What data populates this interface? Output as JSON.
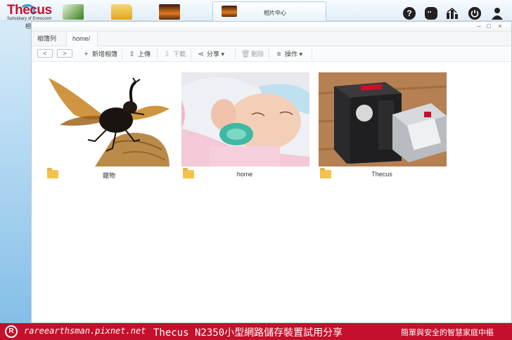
{
  "taskbar": {
    "logo_text": "Thecus",
    "logo_sub": "Subsidiary of Ennoconn",
    "app_under_label": "相片中心",
    "active_tab_label": "相片中心",
    "icons": [
      "help-icon",
      "chat-icon",
      "stats-icon",
      "power-icon",
      "user-icon"
    ]
  },
  "window": {
    "controls": {
      "minimize": "–",
      "maximize": "□",
      "close": "×"
    }
  },
  "breadcrumb": [
    "相簿列表",
    "home/"
  ],
  "toolbar": {
    "prev": "<",
    "next": ">",
    "new_album": "新增相簿",
    "upload": "上傳",
    "download": "下載",
    "share": "分享 ▾",
    "delete": "刪除",
    "operations": "操作 ▾"
  },
  "albums": [
    {
      "name": "寵物",
      "thumbnail": "beetle photo"
    },
    {
      "name": "home",
      "thumbnail": "baby photo"
    },
    {
      "name": "Thecus",
      "thumbnail": "NAS box and hard drive photo"
    }
  ],
  "banner": {
    "site": "rareearthsman.pixnet.net",
    "title": "Thecus N2350小型網路儲存裝置試用分享",
    "tagline": "簡單與安全的智慧家庭中樞"
  }
}
